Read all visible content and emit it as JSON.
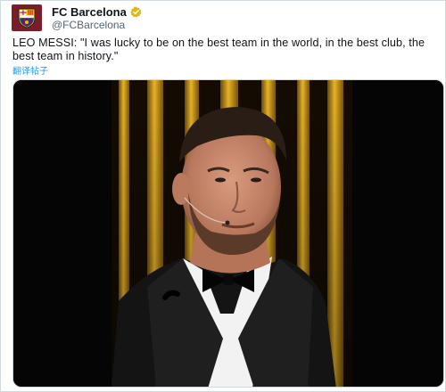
{
  "account": {
    "name": "FC Barcelona",
    "handle": "@FCBarcelona",
    "avatar_icon": "fc-barcelona-crest-icon",
    "verified_icon": "gold-verified-badge-icon",
    "verified_color": "#e2b719"
  },
  "tweet": {
    "text": "LEO MESSI: \"I was lucky to be on the best team in the world, in the best club, the best team in history.\"",
    "translate_label": "翻译帖子"
  },
  "media": {
    "type": "video",
    "description_icon": "video-frame-player-speaking-icon"
  },
  "colors": {
    "link": "#1d9bf0",
    "avatar_bg": "#7a1d2b",
    "stage_gold": "#d9a21d"
  }
}
